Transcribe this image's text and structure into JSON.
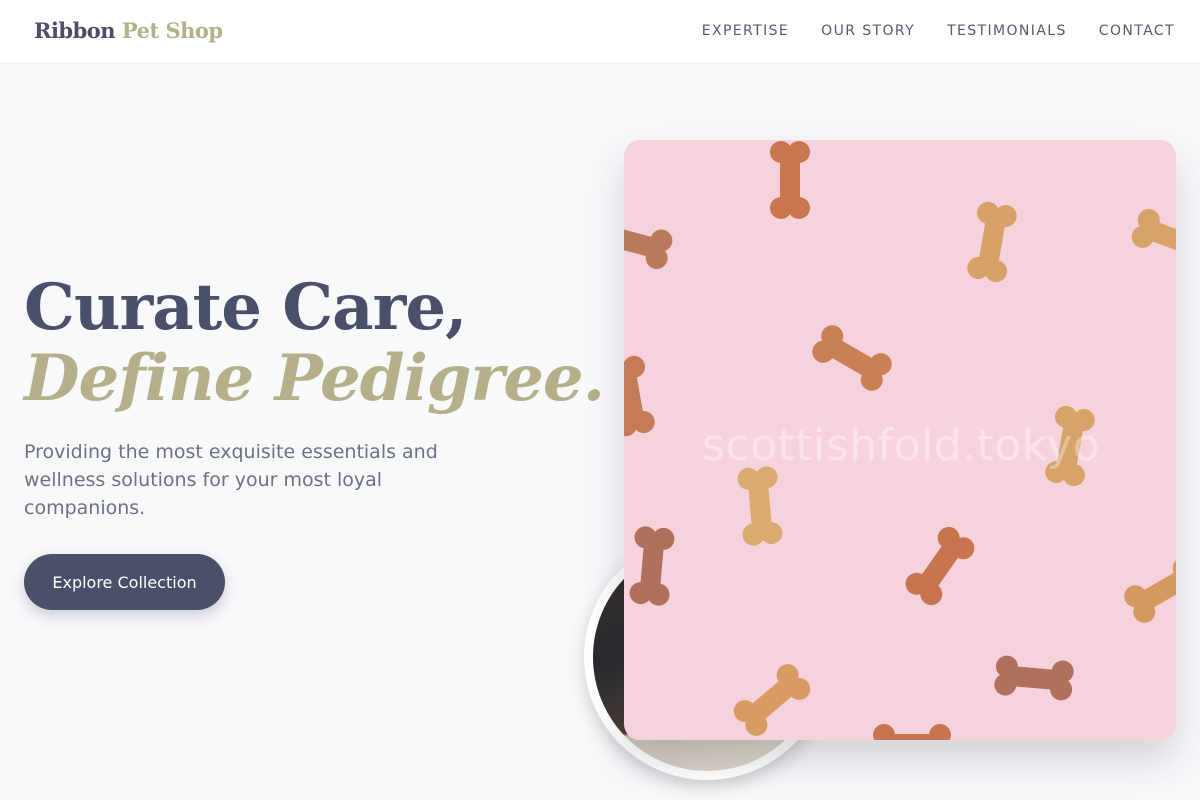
{
  "header": {
    "logo_primary": "Ribbon",
    "logo_accent": "Pet Shop",
    "nav": [
      "EXPERTISE",
      "OUR STORY",
      "TESTIMONIALS",
      "CONTACT"
    ]
  },
  "hero": {
    "title_line1": "Curate Care,",
    "title_line2": "Define Pedigree.",
    "subtitle": "Providing the most exquisite essentials and wellness solutions for your most loyal companions.",
    "cta_label": "Explore Collection"
  },
  "image": {
    "subject": "dog bone biscuits on pink background",
    "watermark": "scottishfold.tokyo"
  },
  "colors": {
    "primary": "#4a4f6a",
    "accent": "#b6b08a",
    "background": "#f8f9fb",
    "image_bg": "#f6d3dc"
  }
}
